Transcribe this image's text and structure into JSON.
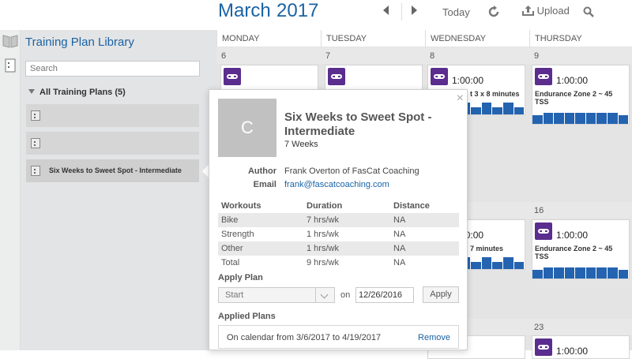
{
  "header": {
    "month": "March",
    "year": "2017",
    "today_label": "Today",
    "upload_label": "Upload",
    "icons": [
      "chevron-left-icon",
      "chevron-right-icon",
      "refresh-icon",
      "upload-icon",
      "search-icon"
    ]
  },
  "library": {
    "title": "Training Plan Library",
    "search_placeholder": "Search",
    "group_label": "All Training Plans (5)",
    "items": [
      {
        "label": ""
      },
      {
        "label": ""
      },
      {
        "label": "Six Weeks to Sweet Spot - Intermediate"
      }
    ]
  },
  "calendar": {
    "days": [
      "MONDAY",
      "TUESDAY",
      "WEDNESDAY",
      "THURSDAY"
    ],
    "week1_dates": [
      "6",
      "7",
      "8",
      "9"
    ],
    "week2_dates": [
      "16"
    ],
    "week3_dates": [
      "23"
    ],
    "workouts": {
      "wed_w1": {
        "time": "1:00:00",
        "name": "t 3 x 8 minutes"
      },
      "thu_w1": {
        "time": "1:00:00",
        "name": "Endurance Zone 2 ~ 45 TSS"
      },
      "wed_w2": {
        "time": "1:00:00",
        "name": "7 minutes"
      },
      "thu_w2": {
        "time": "1:00:00",
        "name": "Endurance Zone 2 ~ 45 TSS"
      },
      "wed_w3": {
        "time": ""
      },
      "thu_w3": {
        "time": "1:00:00"
      }
    }
  },
  "popup": {
    "avatar_letter": "C",
    "title": "Six Weeks to Sweet Spot - Intermediate",
    "duration": "7 Weeks",
    "author_label": "Author",
    "author_value": "Frank Overton of FasCat Coaching",
    "email_label": "Email",
    "email_value": "frank@fascatcoaching.com",
    "table": {
      "headers": [
        "Workouts",
        "Duration",
        "Distance"
      ],
      "rows": [
        [
          "Bike",
          "7 hrs/wk",
          "NA"
        ],
        [
          "Strength",
          "1 hrs/wk",
          "NA"
        ],
        [
          "Other",
          "1 hrs/wk",
          "NA"
        ],
        [
          "Total",
          "9 hrs/wk",
          "NA"
        ]
      ]
    },
    "apply_plan_label": "Apply Plan",
    "select_value": "Start",
    "on_label": "on",
    "date_value": "12/26/2016",
    "apply_button": "Apply",
    "applied_plans_label": "Applied Plans",
    "applied_text": "On calendar from 3/6/2017 to 4/19/2017",
    "remove_label": "Remove"
  },
  "colors": {
    "accent": "#1a63a5",
    "workout_badge": "#5b2d8e",
    "bars": "#2463b0"
  }
}
